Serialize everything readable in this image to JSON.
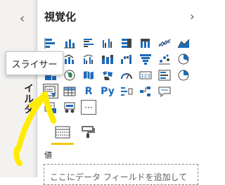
{
  "collapsed_pane": {
    "title": "イルター",
    "chevron": "‹"
  },
  "tooltip": {
    "text": "スライサー"
  },
  "visualizations": {
    "title": "視覚化",
    "chevron": "›",
    "letter_icons": {
      "r": "R",
      "py": "Py"
    },
    "more_label": "···"
  },
  "values_section": {
    "label": "値",
    "placeholder": "ここにデータ フィールドを追加して"
  },
  "colors": {
    "accent_yellow": "#f2c811",
    "icon_blue": "#1e6bb8",
    "annotation": "#ffeb00"
  }
}
